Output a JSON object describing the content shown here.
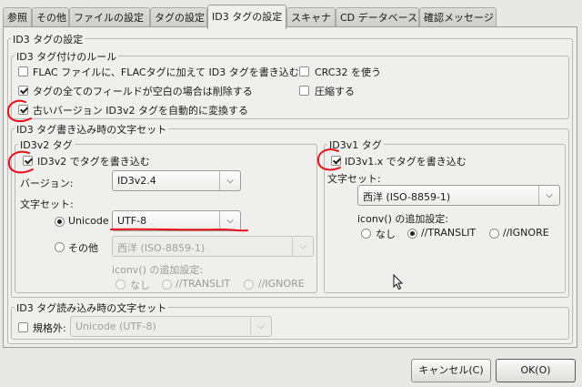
{
  "tabs": [
    "参照",
    "その他",
    "ファイルの設定",
    "タグの設定",
    "ID3 タグの設定",
    "スキャナ",
    "CD データベース",
    "確認メッセージ"
  ],
  "active_tab": 4,
  "id3_settings": {
    "title": "ID3 タグの設定",
    "rules": {
      "title": "ID3 タグ付けのルール",
      "flac_label": "FLAC ファイルに、FLACタグに加えて ID3 タグを書き込む",
      "flac_checked": false,
      "delete_empty_label": "タグの全てのフィールドが空白の場合は削除する",
      "delete_empty_checked": true,
      "auto_convert_label": "古いバージョン ID3v2 タグを自動的に変換する",
      "auto_convert_checked": true,
      "crc32_label": "CRC32 を使う",
      "crc32_checked": false,
      "compress_label": "圧縮する",
      "compress_checked": false
    },
    "write_charset": {
      "title": "ID3 タグ書き込み時の文字セット",
      "id3v2": {
        "title": "ID3v2 タグ",
        "write_label": "ID3v2 でタグを書き込む",
        "write_checked": true,
        "version_label": "バージョン:",
        "version_value": "ID3v2.4",
        "charset_label": "文字セット:",
        "unicode_label": "Unicode",
        "unicode_selected": true,
        "unicode_value": "UTF-8",
        "other_label": "その他",
        "other_value": "西洋 (ISO-8859-1)",
        "iconv_label": "iconv() の追加設定:",
        "iconv_none": "なし",
        "iconv_translit": "//TRANSLIT",
        "iconv_ignore": "//IGNORE"
      },
      "id3v1": {
        "title": "ID3v1 タグ",
        "write_label": "ID3v1.x でタグを書き込む",
        "write_checked": true,
        "charset_label": "文字セット:",
        "charset_value": "西洋 (ISO-8859-1)",
        "iconv_label": "iconv() の追加設定:",
        "iconv_none": "なし",
        "iconv_translit": "//TRANSLIT",
        "iconv_ignore": "//IGNORE",
        "iconv_selected": "//TRANSLIT"
      }
    },
    "read_charset": {
      "title": "ID3 タグ読み込み時の文字セット",
      "nonstandard_label": "規格外:",
      "nonstandard_checked": false,
      "charset_value": "Unicode (UTF-8)"
    }
  },
  "buttons": {
    "cancel": "キャンセル(C)",
    "ok": "OK(O)"
  },
  "annotation_color": "#e8101a"
}
